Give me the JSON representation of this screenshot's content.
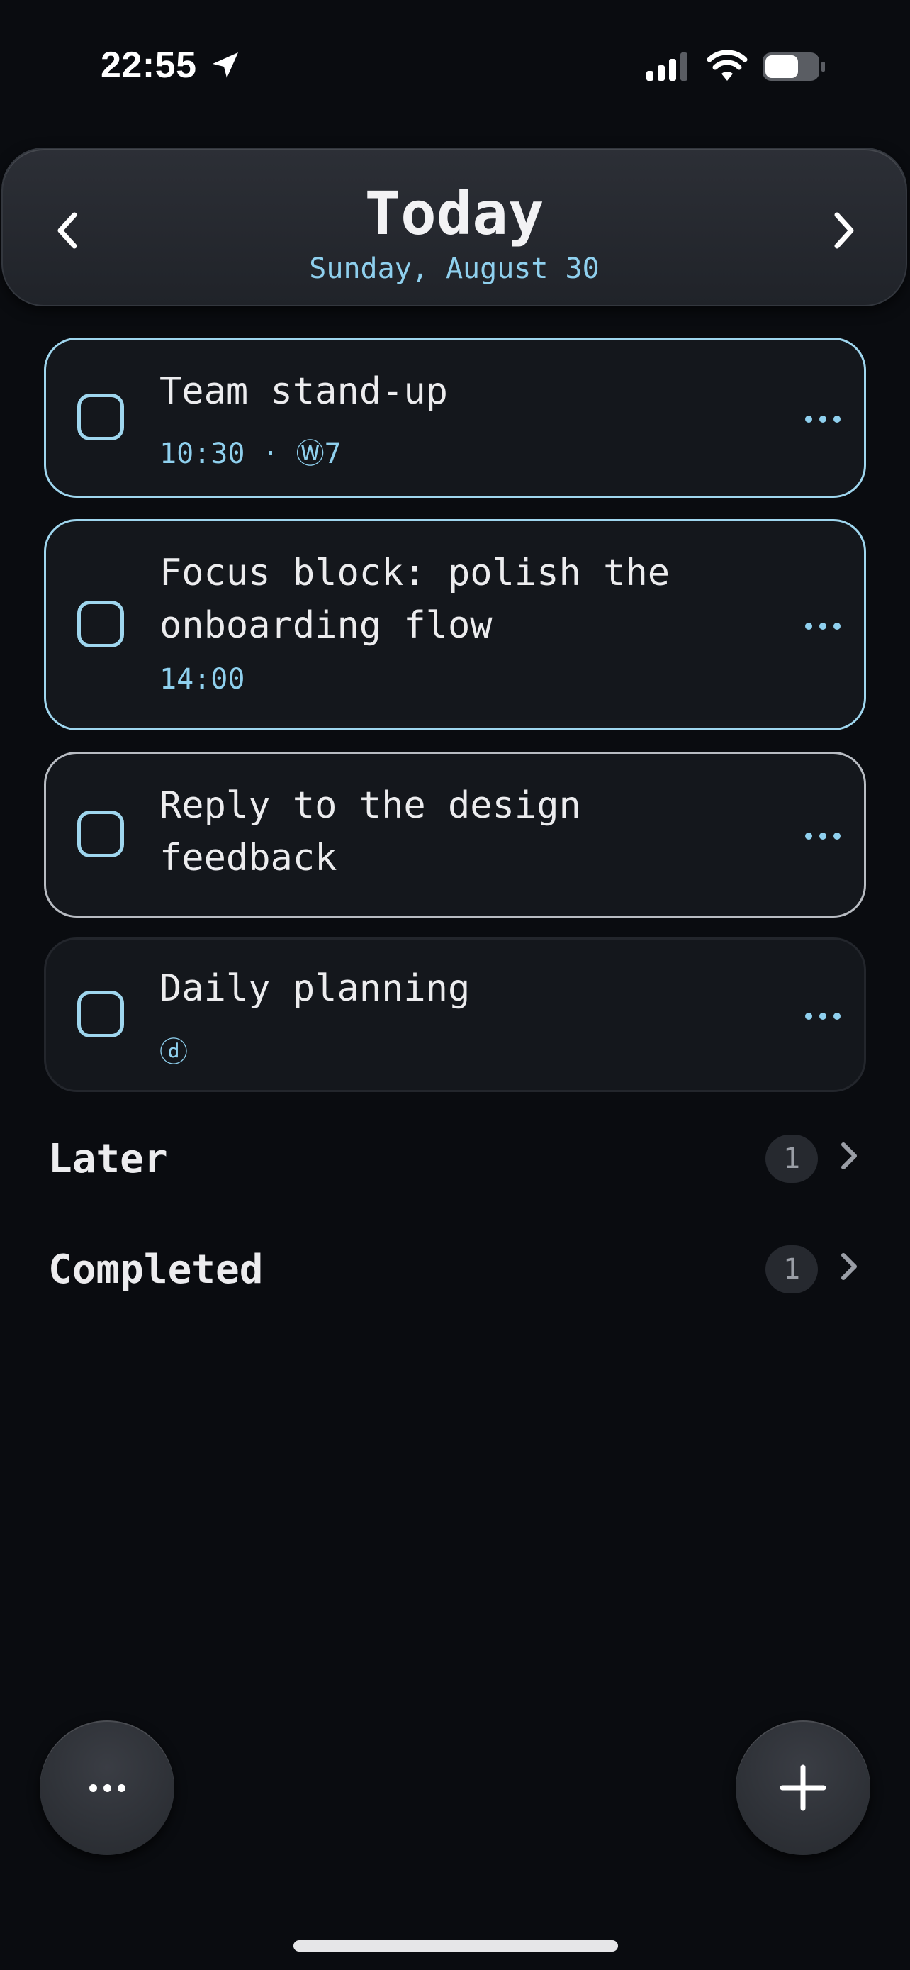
{
  "status_bar": {
    "time": "22:55",
    "location_icon": "location-arrow-icon",
    "signal_icon": "cellular-signal-icon",
    "wifi_icon": "wifi-icon",
    "battery_icon": "battery-icon"
  },
  "header": {
    "title": "Today",
    "date": "Sunday, August 30",
    "prev_icon": "chevron-left-icon",
    "next_icon": "chevron-right-icon"
  },
  "tasks": [
    {
      "title": "Team stand-up",
      "meta": "10:30 · Ⓦ7",
      "border": "#9fd6ee"
    },
    {
      "title": "Focus block: polish the\nonboarding flow",
      "meta": "14:00",
      "border": "#9fd6ee"
    },
    {
      "title": "Reply to the design\nfeedback",
      "meta": "",
      "border": "#b8bcc2"
    },
    {
      "title": "Daily planning",
      "meta": "ⓓ",
      "border": "#23262c"
    }
  ],
  "sections": [
    {
      "label": "Later",
      "count": "1"
    },
    {
      "label": "Completed",
      "count": "1"
    }
  ],
  "bottom_bar": {
    "more_icon": "ellipsis-icon",
    "add_icon": "plus-icon"
  },
  "colors": {
    "background": "#0a0c10",
    "accent": "#8fd0ee",
    "card": "#14171c"
  }
}
